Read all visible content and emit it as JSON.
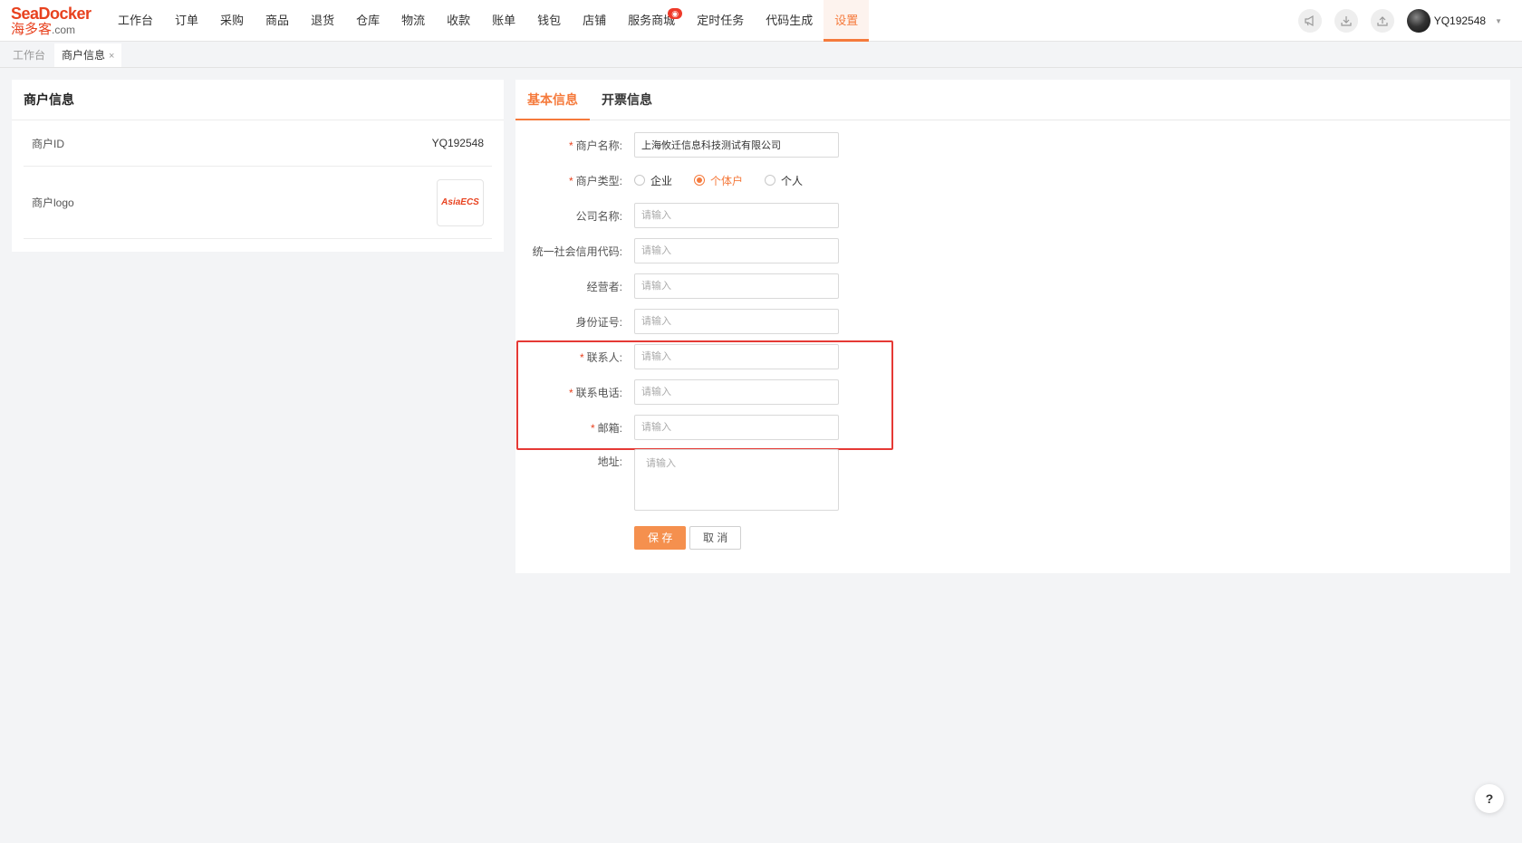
{
  "logo": {
    "brand": "SeaDocker",
    "sub": "海多客",
    "domain": ".com"
  },
  "nav": {
    "items": [
      "工作台",
      "订单",
      "采购",
      "商品",
      "退货",
      "仓库",
      "物流",
      "收款",
      "账单",
      "钱包",
      "店铺",
      "服务商城",
      "定时任务",
      "代码生成",
      "设置"
    ],
    "active": "设置",
    "badge_item": "服务商城"
  },
  "header": {
    "username": "YQ192548",
    "icons": [
      "megaphone-icon",
      "download-icon",
      "upload-icon"
    ]
  },
  "page_tabs": [
    {
      "label": "工作台",
      "active": false
    },
    {
      "label": "商户信息",
      "active": true,
      "close": "×"
    }
  ],
  "merchant_card": {
    "title": "商户信息",
    "id_label": "商户ID",
    "id_value": "YQ192548",
    "logo_label": "商户logo",
    "logo_text": "AsiaECS"
  },
  "form": {
    "tabs": [
      "基本信息",
      "开票信息"
    ],
    "active_tab": "基本信息",
    "name": {
      "label": "商户名称:",
      "value": "上海攸迁信息科技测试有限公司",
      "required": true
    },
    "type": {
      "label": "商户类型:",
      "options": [
        "企业",
        "个体户",
        "个人"
      ],
      "selected": "个体户",
      "required": true
    },
    "company": {
      "label": "公司名称:",
      "placeholder": "请输入"
    },
    "credit_code": {
      "label": "统一社会信用代码:",
      "placeholder": "请输入"
    },
    "operator": {
      "label": "经营者:",
      "placeholder": "请输入"
    },
    "id_number": {
      "label": "身份证号:",
      "placeholder": "请输入"
    },
    "contact": {
      "label": "联系人:",
      "placeholder": "请输入",
      "required": true
    },
    "phone": {
      "label": "联系电话:",
      "placeholder": "请输入",
      "required": true
    },
    "email": {
      "label": "邮箱:",
      "placeholder": "请输入",
      "required": true
    },
    "address": {
      "label": "地址:",
      "placeholder": "请输入"
    },
    "save_label": "保 存",
    "cancel_label": "取 消",
    "required_mark": "*"
  },
  "help_label": "?",
  "colors": {
    "accent": "#f57a3c",
    "brand": "#e8421f",
    "highlight": "#e53935"
  }
}
